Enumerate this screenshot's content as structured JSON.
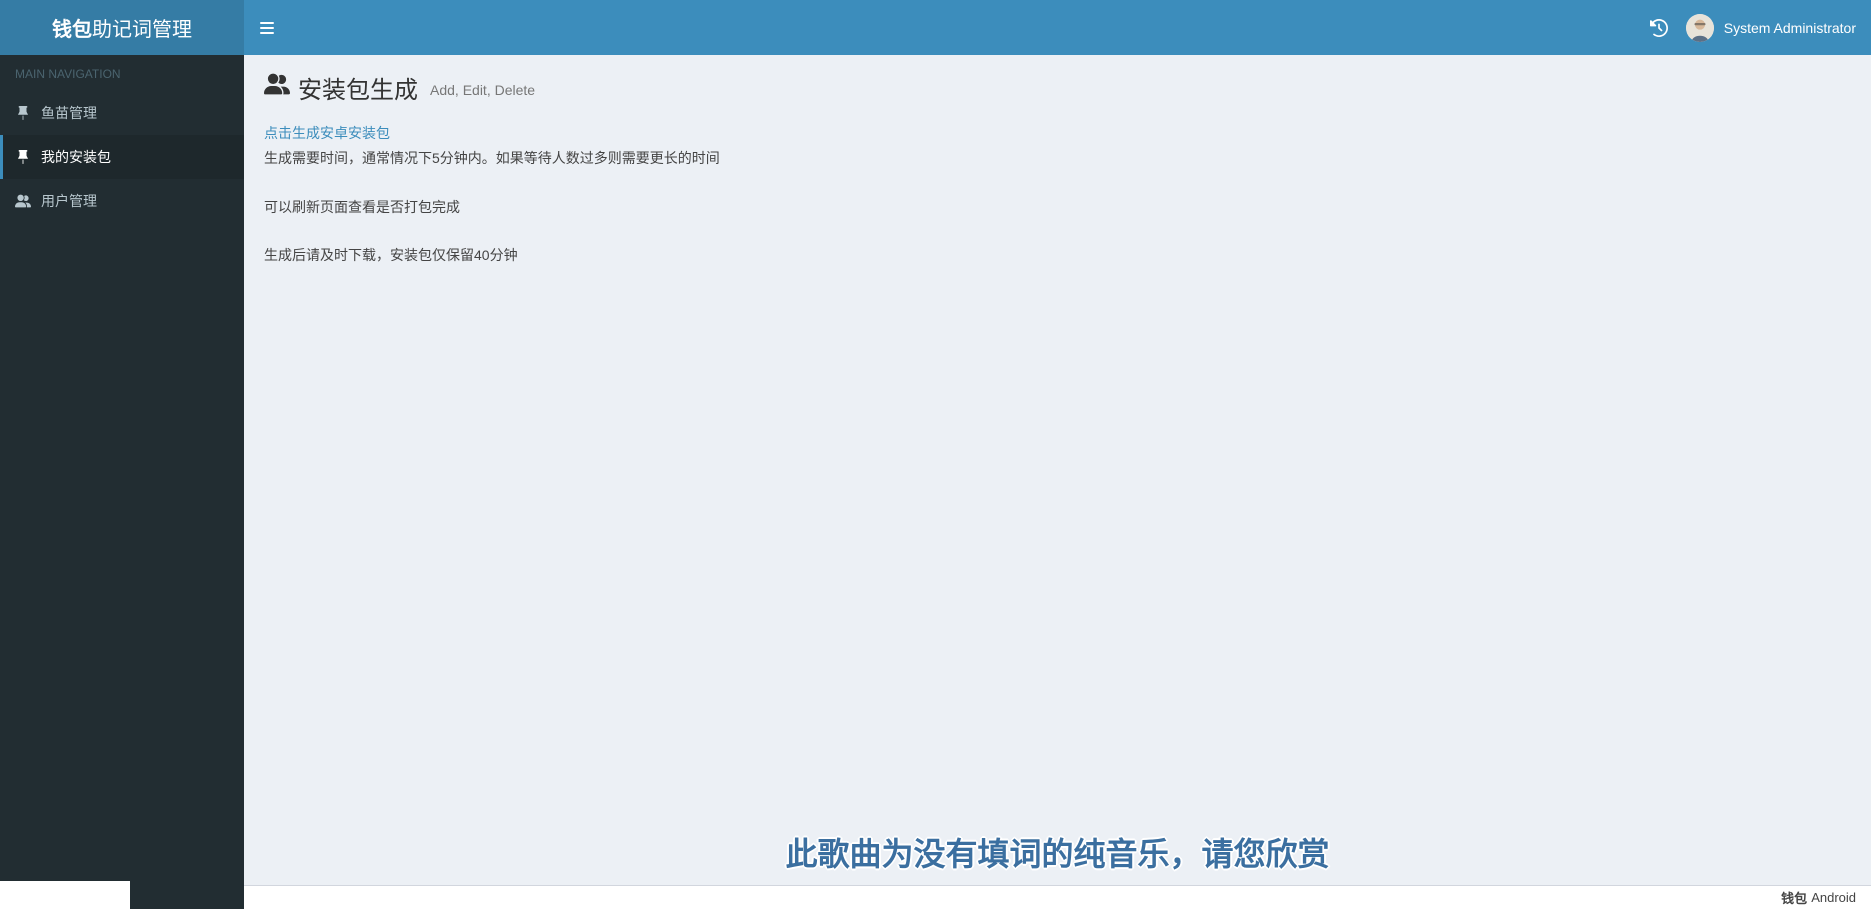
{
  "brand": {
    "bold": "钱包",
    "light": "助记词管理"
  },
  "sidebar": {
    "header": "MAIN NAVIGATION",
    "items": [
      {
        "label": "鱼苗管理",
        "icon": "pin-icon",
        "active": false
      },
      {
        "label": "我的安装包",
        "icon": "pin-icon",
        "active": true
      },
      {
        "label": "用户管理",
        "icon": "users-icon",
        "active": false
      }
    ]
  },
  "topbar": {
    "user_name": "System Administrator"
  },
  "page": {
    "title": "安装包生成",
    "subtitle": "Add, Edit, Delete",
    "generate_link": "点击生成安卓安装包",
    "line1": "生成需要时间，通常情况下5分钟内。如果等待人数过多则需要更长的时间",
    "line2": "可以刷新页面查看是否打包完成",
    "line3": "生成后请及时下载，安装包仅保留40分钟"
  },
  "overlay": {
    "lyric": "此歌曲为没有填词的纯音乐，请您欣赏"
  },
  "footer": {
    "bold": "钱包",
    "rest": "Android"
  }
}
